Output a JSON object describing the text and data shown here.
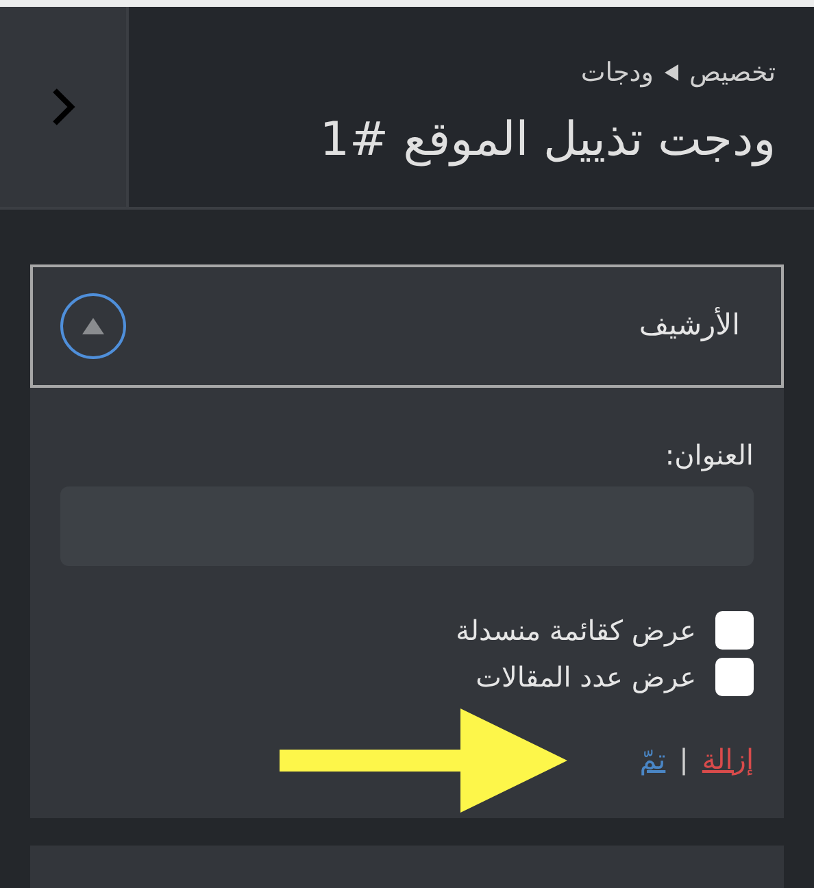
{
  "header": {
    "breadcrumb": [
      "تخصيص",
      "ودجات"
    ],
    "title": "ودجت تذييل الموقع #1"
  },
  "widget": {
    "title": "الأرشيف",
    "expanded": true,
    "field": {
      "label": "العنوان:"
    },
    "options": [
      {
        "label": "عرض كقائمة منسدلة",
        "checked": false
      },
      {
        "label": "عرض عدد المقالات",
        "checked": false
      }
    ],
    "actions": {
      "remove": "إزالة",
      "separator": "|",
      "done": "تمّ"
    }
  }
}
